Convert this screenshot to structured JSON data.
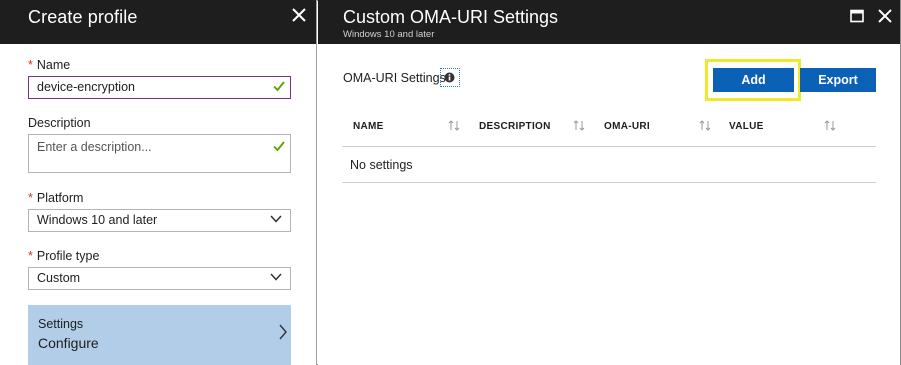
{
  "left_blade": {
    "title": "Create profile",
    "close_icon": "close-icon",
    "name": {
      "label": "Name",
      "required": true,
      "value": "device-encryption",
      "valid_icon": "check-icon"
    },
    "description": {
      "label": "Description",
      "placeholder": "Enter a description...",
      "valid_icon": "check-icon"
    },
    "platform": {
      "label": "Platform",
      "required": true,
      "selected": "Windows 10 and later"
    },
    "profile_type": {
      "label": "Profile type",
      "required": true,
      "selected": "Custom"
    },
    "settings": {
      "title": "Settings",
      "value": "Configure",
      "icon": "chevron-right-icon"
    }
  },
  "right_blade": {
    "title": "Custom OMA-URI Settings",
    "subtitle": "Windows 10 and later",
    "maximize_icon": "maximize-icon",
    "close_icon": "close-icon",
    "section_label": "OMA-URI Settings",
    "info_icon": "info-icon",
    "add_label": "Add",
    "export_label": "Export",
    "table": {
      "columns": [
        "NAME",
        "DESCRIPTION",
        "OMA-URI",
        "VALUE"
      ],
      "empty_text": "No settings"
    }
  },
  "colors": {
    "header_bg": "#1e1e1e",
    "primary_button": "#0a61b6",
    "highlight": "#f0e92a",
    "selected_card": "#b2cde8",
    "valid_check": "#57a300",
    "required_star": "#d93025",
    "active_border": "#7a2f8a"
  }
}
